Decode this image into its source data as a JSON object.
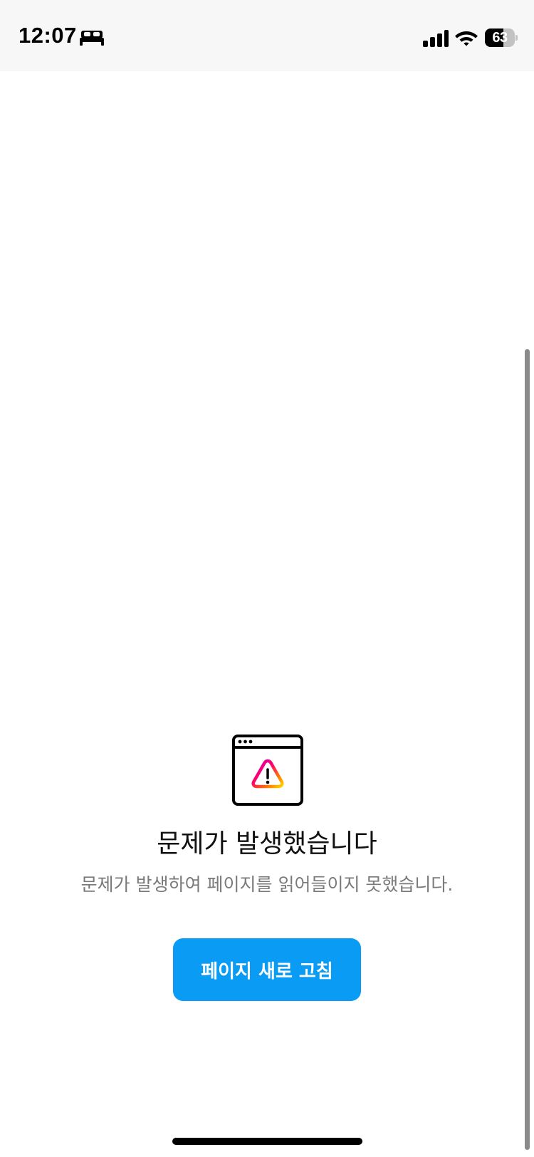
{
  "status_bar": {
    "time": "12:07",
    "battery_level": "63",
    "battery_fraction": 0.63,
    "icons": [
      "sleep-focus-icon",
      "cellular-signal-icon",
      "wifi-icon",
      "battery-icon"
    ]
  },
  "error": {
    "icon": "browser-window-warning-icon",
    "title": "문제가 발생했습니다",
    "message": "문제가 발생하여 페이지를 읽어들이지 못했습니다.",
    "button_label": "페이지 새로 고침"
  },
  "colors": {
    "accent": "#0a9bf5",
    "status_bar_bg": "#f7f7f7",
    "title_text": "#111111",
    "message_text": "#7a7a7a",
    "warning_gradient": [
      "#d300c5",
      "#ff0069",
      "#ff7a00",
      "#ffd600"
    ]
  }
}
